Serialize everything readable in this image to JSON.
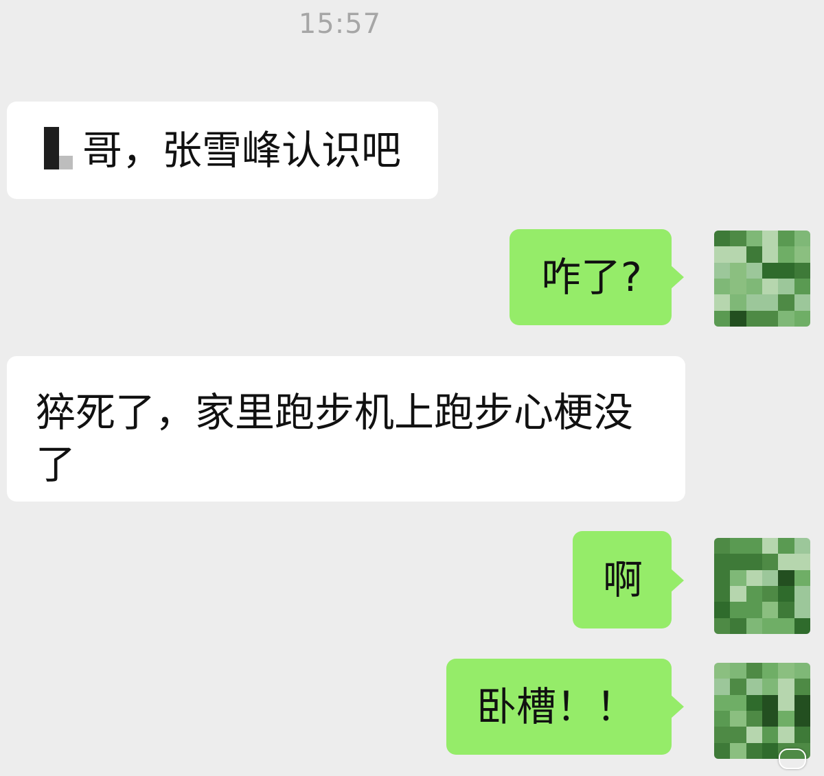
{
  "header": {
    "timestamp": "15:57"
  },
  "messages": [
    {
      "direction": "incoming",
      "text": "哥，张雪峰认识吧",
      "prefix_redacted": true
    },
    {
      "direction": "outgoing",
      "text": "咋了?"
    },
    {
      "direction": "incoming",
      "lines": [
        "猝死了，家里跑步机上跑步心梗没",
        "了"
      ]
    },
    {
      "direction": "outgoing",
      "text": "啊"
    },
    {
      "direction": "outgoing",
      "text": "卧槽！！"
    }
  ],
  "avatar": {
    "style": "pixelated",
    "colors": [
      "#2f6b2c",
      "#5a9a52",
      "#8bbf80",
      "#4e8a45",
      "#9cc79a",
      "#3e7a38",
      "#6fae66",
      "#b6d6ae",
      "#234f20",
      "#7fb877"
    ]
  },
  "colors": {
    "background": "#ededed",
    "incoming_bubble": "#ffffff",
    "outgoing_bubble": "#95ec69",
    "timestamp_text": "#a6a6a6"
  }
}
